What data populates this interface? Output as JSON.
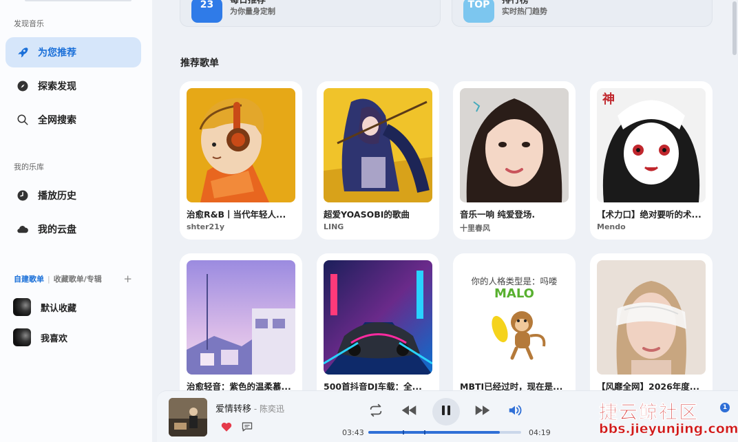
{
  "sidebar": {
    "sections": [
      "发现音乐",
      "我的乐库"
    ],
    "discover_items": [
      {
        "label": "为您推荐",
        "icon": "rocket-icon",
        "active": true
      },
      {
        "label": "探索发现",
        "icon": "compass-icon",
        "active": false
      },
      {
        "label": "全网搜索",
        "icon": "search-icon",
        "active": false
      }
    ],
    "library_items": [
      {
        "label": "播放历史",
        "icon": "clock-icon"
      },
      {
        "label": "我的云盘",
        "icon": "cloud-icon"
      }
    ],
    "playlist_tabs": {
      "active": "自建歌单",
      "other": "收藏歌单/专辑",
      "separator": "|"
    },
    "playlists": [
      {
        "label": "默认收藏"
      },
      {
        "label": "我喜欢"
      }
    ]
  },
  "banners": [
    {
      "icon_text": "23",
      "title": "每日推荐",
      "subtitle": "为你量身定制",
      "color": "#2f7be8"
    },
    {
      "icon_text": "TOP",
      "title": "排行榜",
      "subtitle": "实时热门趋势",
      "color": "#7cc6ef"
    }
  ],
  "recommended": {
    "title": "推荐歌单",
    "playlists": [
      {
        "title": "治愈R&B丨当代年轻人...",
        "author": "shter21y"
      },
      {
        "title": "超爱YOASOBI的歌曲",
        "author": "LING"
      },
      {
        "title": "音乐一响 纯爱登场.",
        "author": "十里春风"
      },
      {
        "title": "【术力口】绝对要听的术...",
        "author": "Mendo"
      },
      {
        "title": "治愈轻音：紫色的温柔慕...",
        "author": ""
      },
      {
        "title": "500首抖音DJ车载：全...",
        "author": ""
      },
      {
        "title": "MBTI已经过时，现在是...",
        "author": "",
        "cover_text": "你的人格类型是：吗喽",
        "cover_highlight": "MALO"
      },
      {
        "title": "【风靡全网】2026年度...",
        "author": ""
      }
    ]
  },
  "player": {
    "song": "爱情转移",
    "separator": " - ",
    "artist": "陈奕迅",
    "current_time": "03:43",
    "total_time": "04:19",
    "progress": 0.86,
    "liked": true
  },
  "watermark": {
    "line1": "捷云鲸社区",
    "line2": "bbs.jieyunjing.com"
  },
  "badge": "1",
  "colors": {
    "accent": "#2f6fd6",
    "active_bg": "#d6e6fa",
    "heart": "#e53b4b"
  }
}
